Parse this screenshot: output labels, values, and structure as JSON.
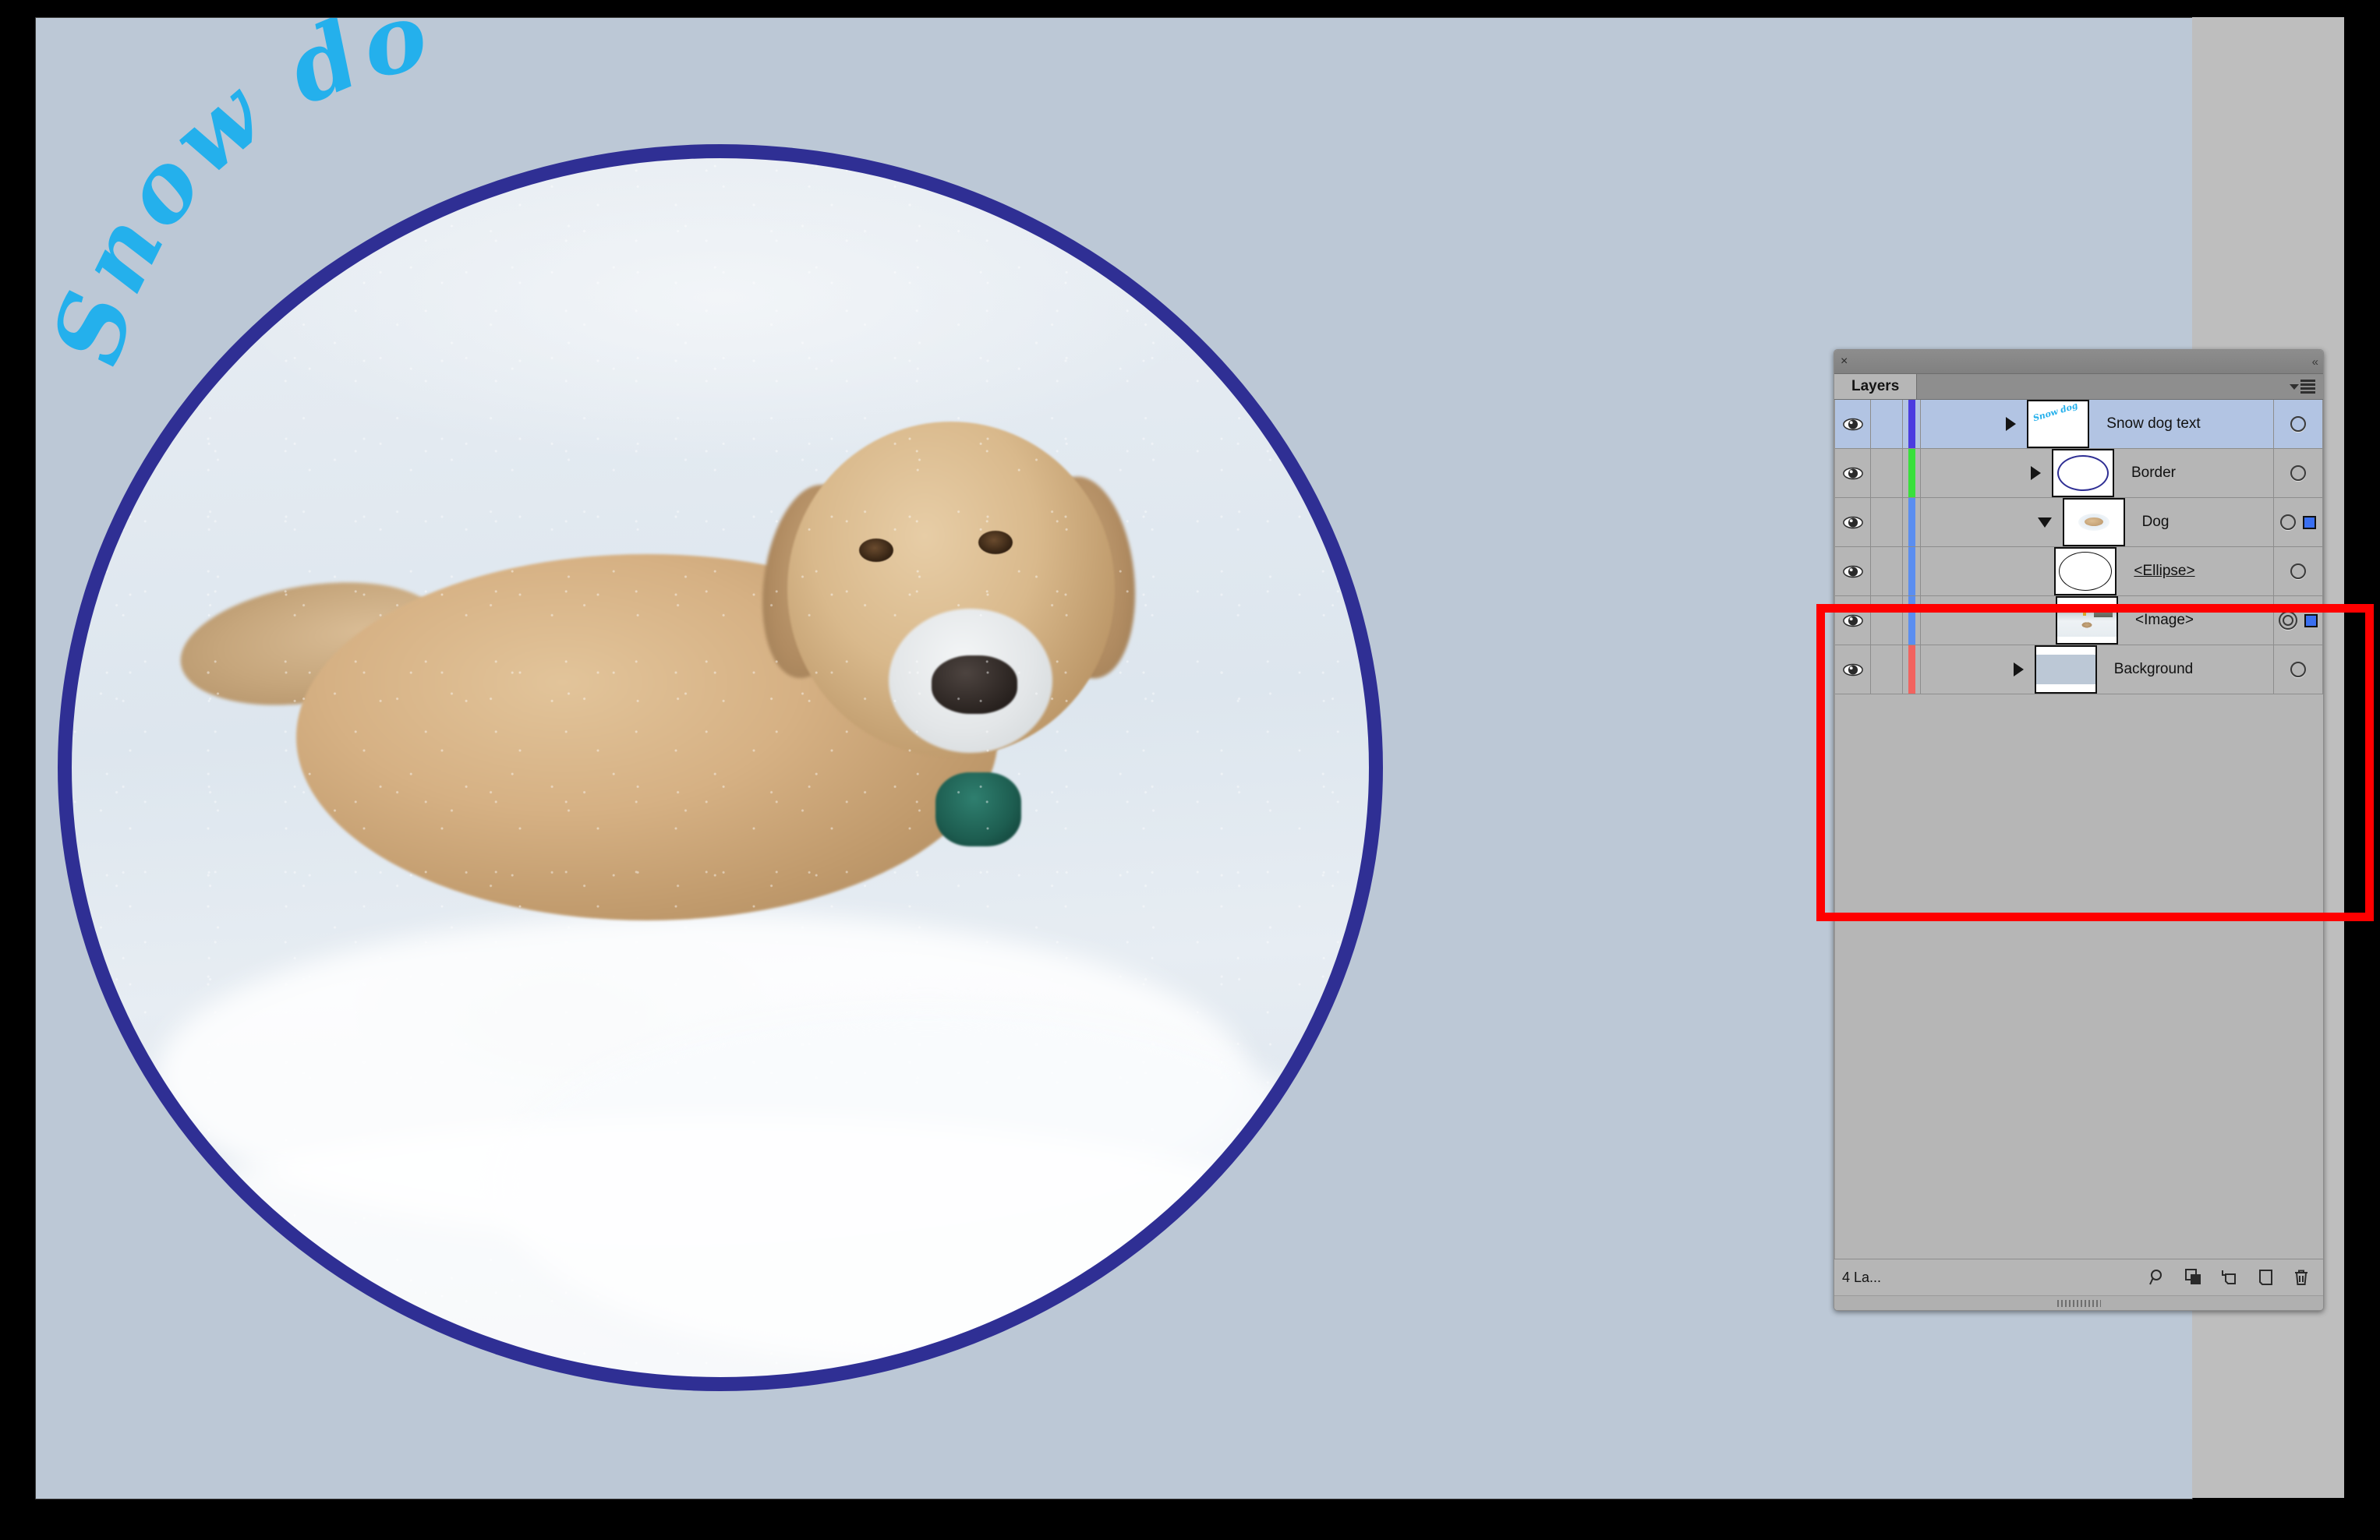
{
  "document": {
    "artwork_title": "Snow dog",
    "title_color": "#24b0ec",
    "border_color": "#2f2f94",
    "background_color": "#bcc8d6"
  },
  "panel": {
    "close_icon": "×",
    "collapse_icon": "«",
    "tab_label": "Layers",
    "menu_icon": "panel-menu",
    "footer": {
      "layer_count": "4 La...",
      "icons": [
        {
          "name": "locate-object-icon",
          "label": "Locate Object"
        },
        {
          "name": "release-to-layers-icon",
          "label": "Make/Release Clipping Mask"
        },
        {
          "name": "create-sublayer-icon",
          "label": "Create New Sublayer"
        },
        {
          "name": "create-layer-icon",
          "label": "Create New Layer"
        },
        {
          "name": "delete-layer-icon",
          "label": "Delete Selection"
        }
      ]
    }
  },
  "layers": [
    {
      "name": "Snow dog text",
      "color": "#4b3ce0",
      "visible": true,
      "selected": true,
      "expanded": false,
      "has_disclosure": true,
      "child": false,
      "targeted": false,
      "has_selection_square": false,
      "name_underlined": false,
      "thumb_type": "text",
      "thumb_text": "Snow dog"
    },
    {
      "name": "Border",
      "color": "#39e03c",
      "visible": true,
      "selected": false,
      "expanded": false,
      "has_disclosure": true,
      "child": false,
      "targeted": false,
      "has_selection_square": false,
      "name_underlined": false,
      "thumb_type": "ellipse-navy"
    },
    {
      "name": "Dog",
      "color": "#5b8ef0",
      "visible": true,
      "selected": false,
      "expanded": true,
      "has_disclosure": true,
      "child": false,
      "targeted": false,
      "has_selection_square": true,
      "name_underlined": false,
      "thumb_type": "dog-ellipse"
    },
    {
      "name": "<Ellipse>",
      "color": "#5b8ef0",
      "visible": true,
      "selected": false,
      "expanded": false,
      "has_disclosure": false,
      "child": true,
      "targeted": false,
      "has_selection_square": false,
      "name_underlined": true,
      "thumb_type": "ellipse-black"
    },
    {
      "name": "<Image>",
      "color": "#5b8ef0",
      "visible": true,
      "selected": false,
      "expanded": false,
      "has_disclosure": false,
      "child": true,
      "targeted": true,
      "has_selection_square": true,
      "name_underlined": false,
      "thumb_type": "photo"
    },
    {
      "name": "Background",
      "color": "#f2635f",
      "visible": true,
      "selected": false,
      "expanded": false,
      "has_disclosure": true,
      "child": false,
      "targeted": false,
      "has_selection_square": false,
      "name_underlined": false,
      "thumb_type": "background"
    }
  ],
  "annotation": {
    "highlight_color": "#ff0000",
    "highlights_rows": [
      "Dog",
      "<Ellipse>",
      "<Image>"
    ]
  }
}
